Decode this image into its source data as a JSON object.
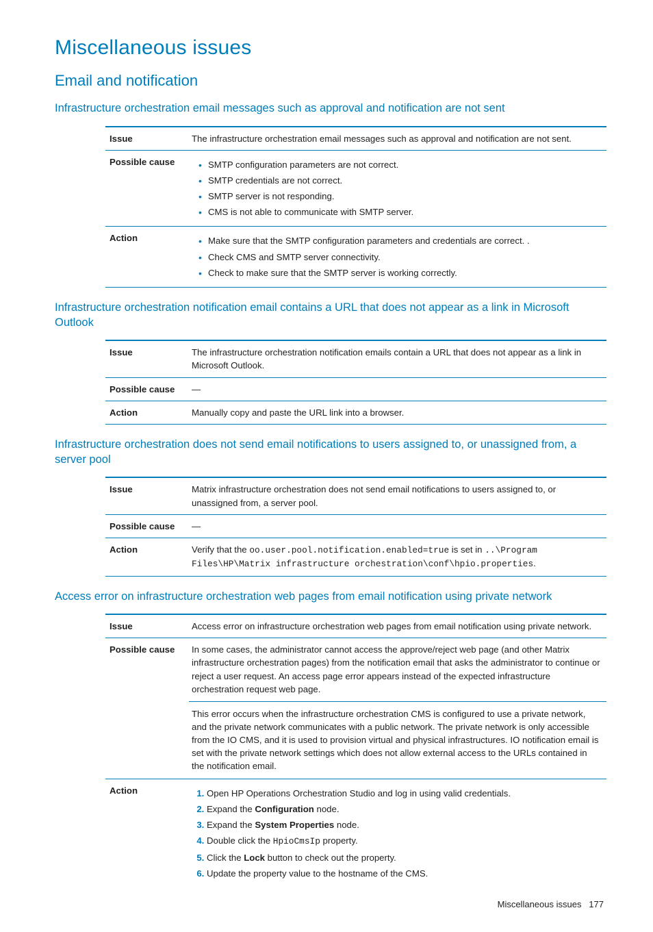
{
  "page": {
    "title": "Miscellaneous issues",
    "section": "Email and notification",
    "footer_label": "Miscellaneous issues",
    "footer_page": "177"
  },
  "topics": [
    {
      "heading": "Infrastructure orchestration email messages such as approval and notification are not sent",
      "rows": {
        "issue_label": "Issue",
        "issue_text": "The infrastructure orchestration email messages such as approval and notification are not sent.",
        "cause_label": "Possible cause",
        "cause_bullets": [
          "SMTP configuration parameters are not correct.",
          "SMTP credentials are not correct.",
          "SMTP server is not responding.",
          "CMS is not able to communicate with SMTP server."
        ],
        "action_label": "Action",
        "action_bullets": [
          "Make sure that the SMTP configuration parameters and credentials are correct. .",
          "Check CMS and SMTP server connectivity.",
          "Check to make sure that the SMTP server is working correctly."
        ]
      }
    },
    {
      "heading": "Infrastructure orchestration notification email contains a URL that does not appear as a link in Microsoft Outlook",
      "rows": {
        "issue_label": "Issue",
        "issue_text": "The infrastructure orchestration notification emails contain a URL that does not appear as a link in Microsoft Outlook.",
        "cause_label": "Possible cause",
        "cause_text": "—",
        "action_label": "Action",
        "action_text": "Manually copy and paste the URL link into a browser."
      }
    },
    {
      "heading": "Infrastructure orchestration does not send email notifications to users assigned to, or unassigned from, a server pool",
      "rows": {
        "issue_label": "Issue",
        "issue_text": "Matrix infrastructure orchestration does not send email notifications to users assigned to, or unassigned from, a server pool.",
        "cause_label": "Possible cause",
        "cause_text": "—",
        "action_label": "Action",
        "action_prefix": "Verify that the ",
        "action_code1": "oo.user.pool.notification.enabled=true",
        "action_mid": " is set in ",
        "action_code2": "..\\Program Files\\HP\\Matrix infrastructure orchestration\\conf\\hpio.properties",
        "action_suffix": "."
      }
    },
    {
      "heading": "Access error on infrastructure orchestration web pages from email notification using private network",
      "rows": {
        "issue_label": "Issue",
        "issue_text": "Access error on infrastructure orchestration web pages from email notification using private network.",
        "cause_label": "Possible cause",
        "cause_para1": "In some cases, the administrator cannot access the approve/reject web page (and other Matrix infrastructure orchestration pages) from the notification email that asks the administrator to continue or reject a user request. An access page error appears instead of the expected infrastructure orchestration request web page.",
        "cause_para2": "This error occurs when the infrastructure orchestration CMS is configured to use a private network, and the private network communicates with a public network. The private network is only accessible from the IO CMS, and it is used to provision virtual and physical infrastructures. IO notification email is set with the private network settings which does not allow external access to the URLs contained in the notification email.",
        "action_label": "Action",
        "action_steps": [
          {
            "text": "Open HP Operations Orchestration Studio and log in using valid credentials."
          },
          {
            "pre": "Expand the ",
            "bold": "Configuration",
            "post": " node."
          },
          {
            "pre": "Expand the ",
            "bold": "System Properties",
            "post": " node."
          },
          {
            "pre": "Double click the ",
            "code": "HpioCmsIp",
            "post": " property."
          },
          {
            "pre": "Click the ",
            "bold": "Lock",
            "post": " button to check out the property."
          },
          {
            "text": "Update the property value to the hostname of the CMS."
          }
        ]
      }
    }
  ]
}
